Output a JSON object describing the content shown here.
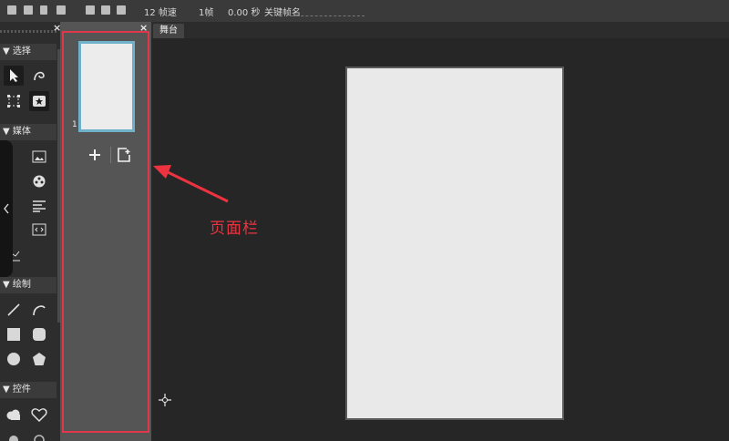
{
  "toolbar": {
    "frames_label": "12 帧速",
    "frame_label": "1帧",
    "time_label": "0.00 秒",
    "keyframe_label": "关键帧名",
    "icons": [
      "new-file-icon",
      "open-folder-icon",
      "delete-icon",
      "copy-icon",
      "page-icon",
      "image-icon",
      "print-icon"
    ]
  },
  "tools_panel": {
    "sections": [
      {
        "label": "选择",
        "tools": [
          "arrow-select-icon",
          "lasso-icon",
          "transform-icon",
          "star-badge-icon"
        ]
      },
      {
        "label": "媒体",
        "tools": [
          "media-grid-icon",
          "image-icon",
          "audio-icon",
          "film-reel-icon",
          "crop-icon",
          "text-align-icon",
          "frame-icon",
          "code-icon",
          "chart-icon"
        ]
      },
      {
        "label": "绘制",
        "tools": [
          "line-icon",
          "curve-icon",
          "rectangle-icon",
          "rounded-rect-icon",
          "circle-icon",
          "pentagon-icon"
        ]
      },
      {
        "label": "控件",
        "tools": [
          "cloud-icon",
          "heart-icon",
          "control-a-icon",
          "control-b-icon"
        ]
      }
    ]
  },
  "pages_panel": {
    "page_number": "1",
    "add_label": "+",
    "icons": [
      "add-page-icon",
      "duplicate-page-icon",
      "close-icon"
    ]
  },
  "stage": {
    "tab_label": "舞台"
  },
  "annotation": {
    "label": "页面栏",
    "color": "#ee3340"
  },
  "colors": {
    "highlight_border": "#e0384a",
    "thumb_border": "#6fb1c8",
    "canvas": "#e9e9e9"
  }
}
